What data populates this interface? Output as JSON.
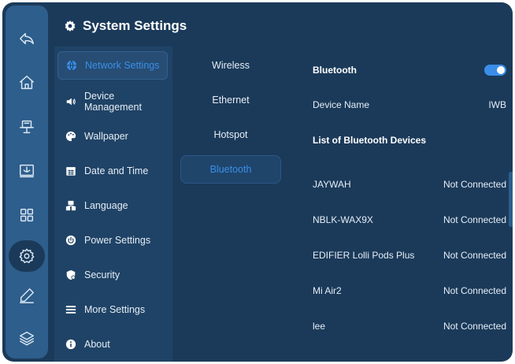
{
  "header": {
    "title": "System Settings",
    "icon": "gear-icon"
  },
  "rail": {
    "items": [
      {
        "name": "back",
        "icon": "back-arrow-icon",
        "active": false
      },
      {
        "name": "home",
        "icon": "home-icon",
        "active": false
      },
      {
        "name": "display",
        "icon": "display-stand-icon",
        "active": false
      },
      {
        "name": "screen-cast",
        "icon": "screen-cast-icon",
        "active": false
      },
      {
        "name": "apps",
        "icon": "apps-grid-icon",
        "active": false
      },
      {
        "name": "settings",
        "icon": "gear-icon",
        "active": true
      },
      {
        "name": "annotate",
        "icon": "pen-icon",
        "active": false
      },
      {
        "name": "layers",
        "icon": "layers-icon",
        "active": false
      }
    ]
  },
  "menu": {
    "items": [
      {
        "label": "Network Settings",
        "icon": "globe-icon",
        "active": true
      },
      {
        "label": "Device Management",
        "label_line1": "Device",
        "label_line2": "Management",
        "icon": "speaker-icon",
        "active": false
      },
      {
        "label": "Wallpaper",
        "icon": "palette-icon",
        "active": false
      },
      {
        "label": "Date and Time",
        "icon": "calendar-icon",
        "active": false
      },
      {
        "label": "Language",
        "icon": "language-icon",
        "active": false
      },
      {
        "label": "Power Settings",
        "icon": "power-icon",
        "active": false
      },
      {
        "label": "Security",
        "icon": "shield-icon",
        "active": false
      },
      {
        "label": "More Settings",
        "icon": "list-icon",
        "active": false
      },
      {
        "label": "About",
        "icon": "info-icon",
        "active": false
      }
    ]
  },
  "submenu": {
    "items": [
      {
        "label": "Wireless",
        "active": false
      },
      {
        "label": "Ethernet",
        "active": false
      },
      {
        "label": "Hotspot",
        "active": false
      },
      {
        "label": "Bluetooth",
        "active": true
      }
    ]
  },
  "detail": {
    "bluetooth": {
      "label": "Bluetooth",
      "enabled": true
    },
    "device_name": {
      "label": "Device Name",
      "value": "IWB"
    },
    "list_title": "List of Bluetooth Devices",
    "devices": [
      {
        "name": "JAYWAH",
        "status": "Not Connected"
      },
      {
        "name": "NBLK-WAX9X",
        "status": "Not Connected"
      },
      {
        "name": "EDIFIER Lolli Pods Plus",
        "status": "Not Connected"
      },
      {
        "name": "Mi Air2",
        "status": "Not Connected"
      },
      {
        "name": "lee",
        "status": "Not Connected"
      }
    ]
  },
  "colors": {
    "background": "#1b3a5a",
    "rail": "#2d5e8c",
    "menu_panel": "#1f4366",
    "accent": "#3a8ee8",
    "text": "#e6edf5"
  }
}
